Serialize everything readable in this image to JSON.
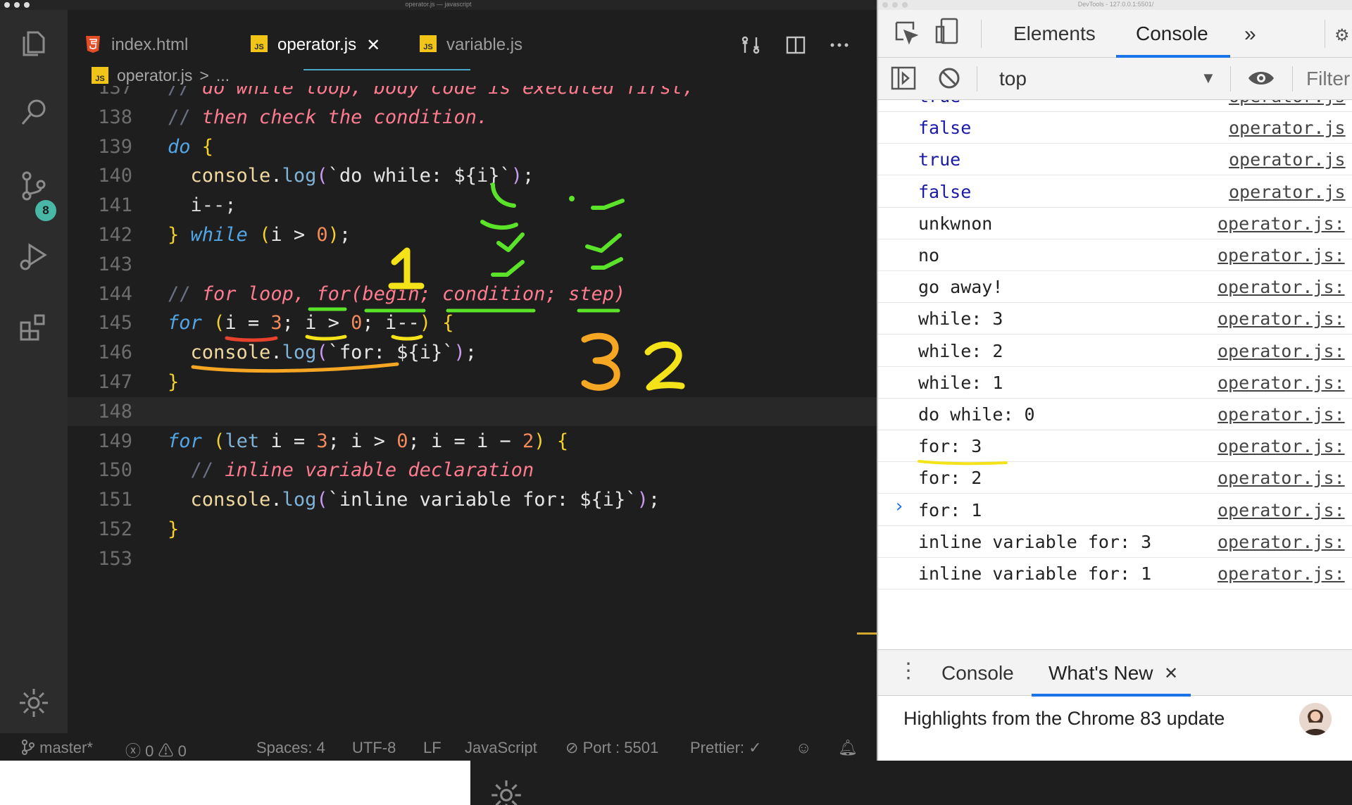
{
  "vscode": {
    "window_title": "operator.js — javascript",
    "tabs": [
      {
        "label": "index.html",
        "type": "html"
      },
      {
        "label": "operator.js",
        "type": "js",
        "active": true
      },
      {
        "label": "variable.js",
        "type": "js"
      }
    ],
    "close_glyph": "✕",
    "breadcrumb": {
      "file": "operator.js",
      "separator": ">",
      "rest": "..."
    },
    "scm_badge": "8",
    "lines": [
      {
        "n": "137",
        "html": "<span class='cmd'>//</span> <span class='cm'>do while loop, body code is executed first,</span>"
      },
      {
        "n": "138",
        "html": "<span class='cmd'>//</span> <span class='cm'>then check the condition.</span>"
      },
      {
        "n": "139",
        "html": "<span class='kw'>do</span> <span class='pn'>{</span>"
      },
      {
        "n": "140",
        "html": "  <span class='obj'>console</span>.<span class='fn'>log</span><span class='tpl'>(</span>`<span class='str'>do while: </span>${<span class='op'>i</span>}`<span class='tpl'>)</span>;"
      },
      {
        "n": "141",
        "html": "  <span class='op'>i--;</span>"
      },
      {
        "n": "142",
        "html": "<span class='pn'>}</span> <span class='kw'>while</span> <span class='pn'>(</span>i &gt; <span class='num'>0</span><span class='pn'>)</span>;"
      },
      {
        "n": "143",
        "html": ""
      },
      {
        "n": "144",
        "html": "<span class='cmd'>//</span> <span class='cm'>for loop, for(begin; condition; step)</span>"
      },
      {
        "n": "145",
        "html": "<span class='kw'>for</span> <span class='pn'>(</span>i = <span class='num'>3</span>; i &gt; <span class='num'>0</span>; i--<span class='pn'>)</span> <span class='pn'>{</span>"
      },
      {
        "n": "146",
        "html": "  <span class='obj'>console</span>.<span class='fn'>log</span><span class='tpl'>(</span>`<span class='str'>for: </span>${<span class='op'>i</span>}`<span class='tpl'>)</span>;"
      },
      {
        "n": "147",
        "html": "<span class='pn'>}</span>"
      },
      {
        "n": "148",
        "html": "",
        "current": true
      },
      {
        "n": "149",
        "html": "<span class='kw'>for</span> <span class='pn'>(</span><span class='fn'>let</span> i = <span class='num'>3</span>; i &gt; <span class='num'>0</span>; i = i − <span class='num'>2</span><span class='pn'>)</span> <span class='pn'>{</span>"
      },
      {
        "n": "150",
        "html": "  <span class='cmd'>//</span> <span class='cm'>inline variable declaration</span>"
      },
      {
        "n": "151",
        "html": "  <span class='obj'>console</span>.<span class='fn'>log</span><span class='tpl'>(</span>`<span class='str'>inline variable for: </span>${<span class='op'>i</span>}`<span class='tpl'>)</span>;"
      },
      {
        "n": "152",
        "html": "<span class='pn'>}</span>"
      },
      {
        "n": "153",
        "html": ""
      }
    ],
    "status": {
      "branch": "master*",
      "errors": "0",
      "warnings": "0",
      "spaces": "Spaces: 4",
      "encoding": "UTF-8",
      "eol": "LF",
      "language": "JavaScript",
      "port": "Port : 5501",
      "prettier": "Prettier: ✓"
    }
  },
  "devtools": {
    "window_title": "DevTools - 127.0.0.1:5501/",
    "tabs": [
      "Elements",
      "Console"
    ],
    "more_glyph": "»",
    "context": "top",
    "filter_placeholder": "Filter",
    "logs": [
      {
        "msg": "true",
        "src": "operator.js",
        "bool": true
      },
      {
        "msg": "false",
        "src": "operator.js",
        "bool": true
      },
      {
        "msg": "true",
        "src": "operator.js",
        "bool": true
      },
      {
        "msg": "false",
        "src": "operator.js",
        "bool": true
      },
      {
        "msg": "unkwnon",
        "src": "operator.js:"
      },
      {
        "msg": "no",
        "src": "operator.js:"
      },
      {
        "msg": "go away!",
        "src": "operator.js:"
      },
      {
        "msg": "while: 3",
        "src": "operator.js:"
      },
      {
        "msg": "while: 2",
        "src": "operator.js:"
      },
      {
        "msg": "while: 1",
        "src": "operator.js:"
      },
      {
        "msg": "do while: 0",
        "src": "operator.js:"
      },
      {
        "msg": "for: 3",
        "src": "operator.js:"
      },
      {
        "msg": "for: 2",
        "src": "operator.js:"
      },
      {
        "msg": "for: 1",
        "src": "operator.js:"
      },
      {
        "msg": "inline variable for: 3",
        "src": "operator.js:"
      },
      {
        "msg": "inline variable for: 1",
        "src": "operator.js:"
      }
    ],
    "prompt": "›",
    "drawer": {
      "tabs": [
        "Console",
        "What's New"
      ],
      "close_glyph": "✕",
      "highlight": "Highlights from the Chrome 83 update"
    }
  },
  "annotations": {
    "numbers": [
      "1",
      "3",
      "2"
    ],
    "colors": {
      "green": "#5be32a",
      "yellow": "#f5e31a",
      "orange": "#f5a623",
      "red": "#e8412c"
    }
  },
  "colors": {
    "editor_bg": "#1e1e1e",
    "keyword": "#53a6e6",
    "comment": "#ff7b8f",
    "number": "#f28a5b",
    "devtools_accent": "#1a73e8"
  }
}
